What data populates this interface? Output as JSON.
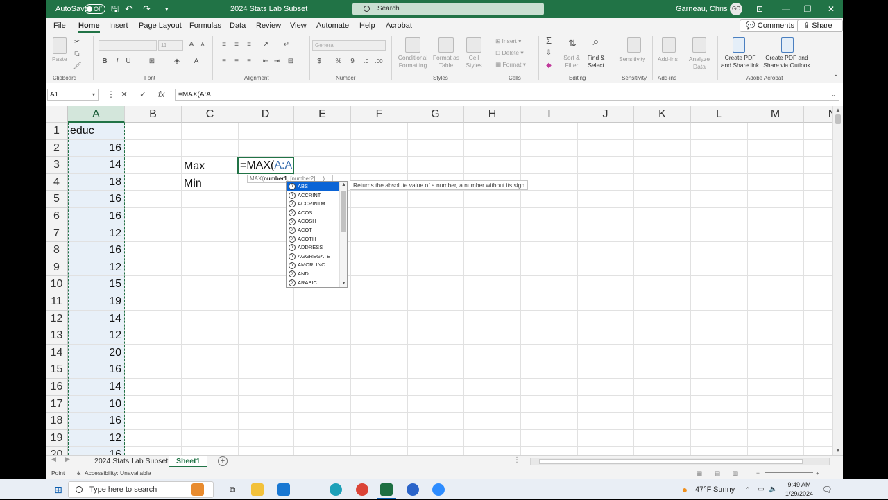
{
  "titlebar": {
    "autosave_label": "AutoSave",
    "autosave_state": "Off",
    "doc_title": "2024 Stats Lab Subset",
    "search_placeholder": "Search",
    "user_name": "Garneau, Chris R.",
    "user_initials": "GC"
  },
  "menu": {
    "items": [
      "File",
      "Home",
      "Insert",
      "Page Layout",
      "Formulas",
      "Data",
      "Review",
      "View",
      "Automate",
      "Help",
      "Acrobat"
    ],
    "active": "Home",
    "comments_label": "Comments",
    "share_label": "Share"
  },
  "ribbon": {
    "clipboard": {
      "label": "Clipboard",
      "paste": "Paste"
    },
    "font": {
      "label": "Font",
      "size": "11",
      "bold": "B",
      "italic": "I",
      "underline": "U"
    },
    "alignment": {
      "label": "Alignment"
    },
    "number": {
      "label": "Number",
      "format": "General",
      "currency": "$",
      "percent": "%",
      "comma": "9"
    },
    "styles": {
      "label": "Styles",
      "conditional": "Conditional\nFormatting",
      "format_table": "Format as\nTable",
      "cell_styles": "Cell\nStyles"
    },
    "cells": {
      "label": "Cells",
      "insert": "Insert",
      "delete": "Delete",
      "format": "Format"
    },
    "editing": {
      "label": "Editing",
      "sort": "Sort &\nFilter",
      "find": "Find &\nSelect"
    },
    "sensitivity": {
      "label": "Sensitivity",
      "btn": "Sensitivity"
    },
    "addins": {
      "label": "Add-ins",
      "btn": "Add-ins",
      "analyze": "Analyze\nData"
    },
    "acrobat": {
      "label": "Adobe Acrobat",
      "create_pdf": "Create PDF\nand Share link",
      "create_pdf_outlook": "Create PDF and\nShare via Outlook"
    }
  },
  "formula_bar": {
    "name_box": "A1",
    "cancel": "✕",
    "enter": "✓",
    "fx": "fx",
    "content": "=MAX(A:A"
  },
  "grid": {
    "columns": [
      "A",
      "B",
      "C",
      "D",
      "E",
      "F",
      "G",
      "H",
      "I",
      "J",
      "K",
      "L",
      "M",
      "N"
    ],
    "rows": [
      "1",
      "2",
      "3",
      "4",
      "5",
      "6",
      "7",
      "8",
      "9",
      "10",
      "11",
      "12",
      "13",
      "14",
      "15",
      "16",
      "17",
      "18",
      "19",
      "20"
    ],
    "col_a_values": [
      "educ",
      "16",
      "14",
      "18",
      "16",
      "16",
      "12",
      "16",
      "12",
      "15",
      "19",
      "14",
      "12",
      "20",
      "16",
      "14",
      "10",
      "16",
      "12",
      "16"
    ],
    "c3": "Max",
    "c4": "Min",
    "active_prefix": "=MAX(",
    "active_ref": "A:A"
  },
  "autocomplete": {
    "signature_fn": "MAX(",
    "signature_arg1": "number1",
    "signature_rest": ", [number2], ...)",
    "items": [
      "ABS",
      "ACCRINT",
      "ACCRINTM",
      "ACOS",
      "ACOSH",
      "ACOT",
      "ACOTH",
      "ADDRESS",
      "AGGREGATE",
      "AMORLINC",
      "AND",
      "ARABIC"
    ],
    "selected": "ABS",
    "description": "Returns the absolute value of a number, a number without its sign"
  },
  "sheets": {
    "tabs": [
      "2024 Stats Lab Subset",
      "Sheet1"
    ],
    "active": "Sheet1",
    "add": "+"
  },
  "statusbar": {
    "mode": "Point",
    "accessibility": "Accessibility: Unavailable"
  },
  "taskbar": {
    "search_placeholder": "Type here to search",
    "weather_temp": "47°F",
    "weather_desc": "Sunny",
    "time": "9:49 AM",
    "date": "1/29/2024"
  },
  "colors": {
    "excel_green": "#217346",
    "selection_blue": "#0a64d6",
    "reference_blue": "#3a6fb0"
  }
}
